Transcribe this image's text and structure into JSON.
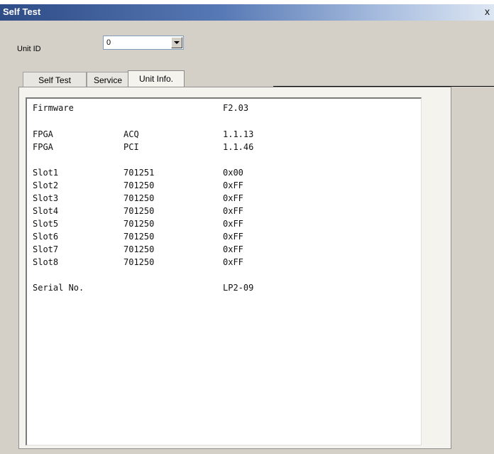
{
  "window": {
    "title": "Self Test",
    "close_label": "x"
  },
  "unit_id": {
    "label": "Unit ID",
    "value": "0"
  },
  "tabs": [
    {
      "label": "Self Test",
      "active": false
    },
    {
      "label": "Service",
      "active": false
    },
    {
      "label": "Unit Info.",
      "active": true
    }
  ],
  "unit_info": {
    "firmware": {
      "name": "Firmware",
      "value": "F2.03"
    },
    "fpga": [
      {
        "name": "FPGA",
        "type": "ACQ",
        "version": "1.1.13"
      },
      {
        "name": "FPGA",
        "type": "PCI",
        "version": "1.1.46"
      }
    ],
    "slots": [
      {
        "name": "Slot1",
        "model": "701251",
        "status": "0x00"
      },
      {
        "name": "Slot2",
        "model": "701250",
        "status": "0xFF"
      },
      {
        "name": "Slot3",
        "model": "701250",
        "status": "0xFF"
      },
      {
        "name": "Slot4",
        "model": "701250",
        "status": "0xFF"
      },
      {
        "name": "Slot5",
        "model": "701250",
        "status": "0xFF"
      },
      {
        "name": "Slot6",
        "model": "701250",
        "status": "0xFF"
      },
      {
        "name": "Slot7",
        "model": "701250",
        "status": "0xFF"
      },
      {
        "name": "Slot8",
        "model": "701250",
        "status": "0xFF"
      }
    ],
    "serial": {
      "name": "Serial No.",
      "value": "LP2-09"
    }
  }
}
